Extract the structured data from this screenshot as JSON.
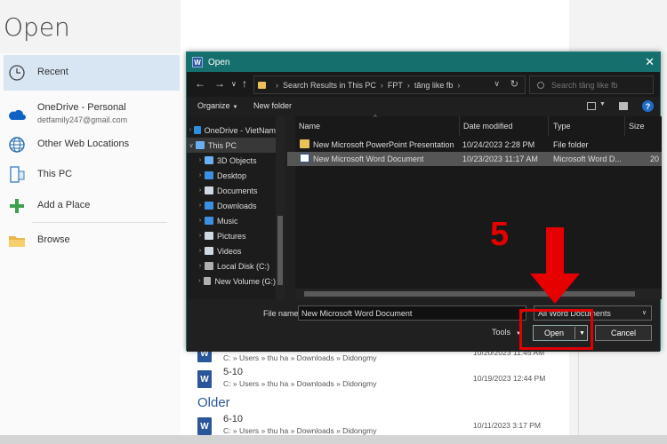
{
  "backstage": {
    "title": "Open",
    "places": [
      {
        "label": "Recent",
        "sub": "",
        "icon": "clock-icon",
        "selected": true
      },
      {
        "label": "OneDrive - Personal",
        "sub": "detfamily247@gmail.com",
        "icon": "onedrive-cloud-icon"
      },
      {
        "label": "Other Web Locations",
        "sub": "",
        "icon": "globe-icon"
      },
      {
        "label": "This PC",
        "sub": "",
        "icon": "computer-icon"
      },
      {
        "label": "Add a Place",
        "sub": "",
        "icon": "plus-icon"
      },
      {
        "label": "Browse",
        "sub": "",
        "icon": "folder-icon"
      }
    ],
    "recent_files": [
      {
        "name": "",
        "path": "C: » Users » thu ha » Downloads » Didongmy",
        "date": "10/20/2023 11:45 AM"
      },
      {
        "name": "5-10",
        "path": "C: » Users » thu ha » Downloads » Didongmy",
        "date": "10/19/2023 12:44 PM"
      }
    ],
    "older_label": "Older",
    "older_files": [
      {
        "name": "6-10",
        "path": "C: » Users » thu ha » Downloads » Didongmy",
        "date": "10/11/2023 3:17 PM"
      }
    ],
    "file_icon_letter": "W"
  },
  "dialog": {
    "title": "Open",
    "nav": {
      "back": "←",
      "forward": "→",
      "dropdown": "∨",
      "up": "↑"
    },
    "breadcrumb": [
      "Search Results in This PC",
      "FPT",
      "tăng like fb"
    ],
    "search_placeholder": "Search tăng like fb",
    "toolbar": {
      "organize": "Organize",
      "new_folder": "New folder",
      "help": "?"
    },
    "nav_pane": [
      {
        "label": "OneDrive - VietNam",
        "icon": "onedrive-cloud-icon",
        "color": "#2f8fdf",
        "expand": "›"
      },
      {
        "label": "This PC",
        "icon": "computer-icon",
        "color": "#6ab0f0",
        "expand": "∨",
        "selected": true
      },
      {
        "label": "3D Objects",
        "icon": "3d-objects-icon",
        "color": "#6ab0f0",
        "expand": "›"
      },
      {
        "label": "Desktop",
        "icon": "desktop-icon",
        "color": "#3d8fe0",
        "expand": "›"
      },
      {
        "label": "Documents",
        "icon": "documents-icon",
        "color": "#cfd8e3",
        "expand": "›"
      },
      {
        "label": "Downloads",
        "icon": "downloads-icon",
        "color": "#3d8fe0",
        "expand": "›"
      },
      {
        "label": "Music",
        "icon": "music-icon",
        "color": "#3d8fe0",
        "expand": "›"
      },
      {
        "label": "Pictures",
        "icon": "pictures-icon",
        "color": "#cfd8e3",
        "expand": "›"
      },
      {
        "label": "Videos",
        "icon": "videos-icon",
        "color": "#cfd8e3",
        "expand": "›"
      },
      {
        "label": "Local Disk (C:)",
        "icon": "drive-icon",
        "color": "#b0b0b0",
        "expand": "›"
      },
      {
        "label": "New Volume (G:)",
        "icon": "drive-icon",
        "color": "#b0b0b0",
        "expand": "›"
      }
    ],
    "columns": {
      "name": "Name",
      "date": "Date modified",
      "type": "Type",
      "size": "Size"
    },
    "files": [
      {
        "name": "New Microsoft PowerPoint Presentation",
        "date": "10/24/2023 2:28 PM",
        "type": "File folder",
        "size": "",
        "icon": "folder-icon",
        "color": "#e8c15a",
        "selected": false
      },
      {
        "name": "New Microsoft Word Document",
        "date": "10/23/2023 11:17 AM",
        "type": "Microsoft Word D...",
        "size": "20",
        "icon": "word-doc-icon",
        "color": "#ffffff",
        "selected": true
      }
    ],
    "file_name_label": "File name:",
    "file_name_value": "New Microsoft Word Document",
    "file_type": "All Word Documents",
    "tools": "Tools",
    "open": "Open",
    "cancel": "Cancel"
  },
  "annotation": {
    "step": "5",
    "color": "#e60000"
  }
}
